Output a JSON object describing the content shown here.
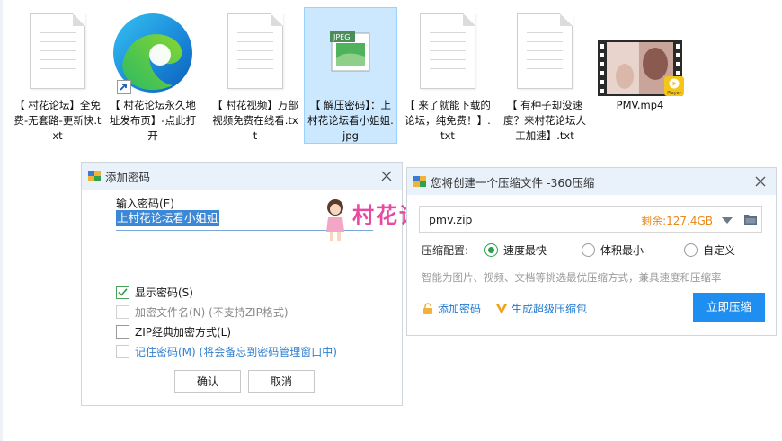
{
  "desktop": {
    "files": [
      {
        "label": "【 村花论坛】全免费-无套路-更新快.txt",
        "type": "txt"
      },
      {
        "label": "【 村花论坛永久地址发布页】-点此打开",
        "type": "edge-shortcut"
      },
      {
        "label": "【 村花视频】万部视频免费在线看.txt",
        "type": "txt"
      },
      {
        "label": "【 解压密码】：上村花论坛看小姐姐.jpg",
        "type": "jpeg",
        "badge": "JPEG"
      },
      {
        "label": "【 来了就能下载的论坛，纯免费！】.txt",
        "type": "txt"
      },
      {
        "label": "【 有种子却没速度？来村花论坛人工加速】.txt",
        "type": "txt"
      },
      {
        "label": "PMV.mp4",
        "type": "video",
        "badge": "Player"
      }
    ]
  },
  "password_dialog": {
    "title": "添加密码",
    "input_label": "输入密码(E)",
    "password_value": "上村花论坛看小姐姐",
    "options": [
      {
        "label": "显示密码(S)",
        "checked": true,
        "enabled": true
      },
      {
        "label": "加密文件名(N) (不支持ZIP格式)",
        "checked": false,
        "enabled": false
      },
      {
        "label": "ZIP经典加密方式(L)",
        "checked": false,
        "enabled": true
      },
      {
        "label": "记住密码(M) (将会备忘到密码管理窗口中)",
        "checked": false,
        "enabled": true
      }
    ],
    "ok_label": "确认",
    "cancel_label": "取消"
  },
  "zip_dialog": {
    "title": "您将创建一个压缩文件 -360压缩",
    "filename": "pmv.zip",
    "free_space": "剩余:127.4GB",
    "config_label": "压缩配置:",
    "modes": [
      {
        "label": "速度最快",
        "selected": true
      },
      {
        "label": "体积最小",
        "selected": false
      },
      {
        "label": "自定义",
        "selected": false
      }
    ],
    "hint": "智能为图片、视频、文档等挑选最优压缩方式，兼具速度和压缩率",
    "add_password_label": "添加密码",
    "super_zip_label": "生成超级压缩包",
    "submit_label": "立即压缩"
  },
  "watermark": "村花论坛",
  "colors": {
    "accent": "#1e8ff0",
    "orange": "#e8891b",
    "green": "#2aa04a",
    "watermark": "#e84aa2"
  }
}
